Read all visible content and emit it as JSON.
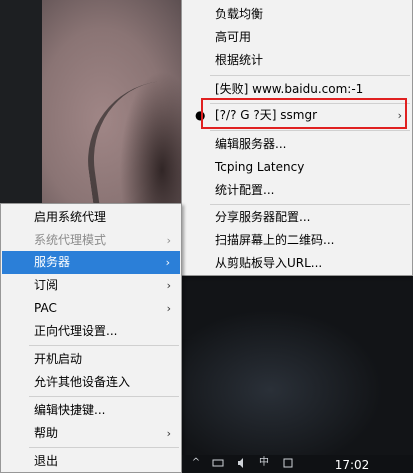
{
  "server_menu": {
    "items": [
      {
        "label": "负载均衡"
      },
      {
        "label": "高可用"
      },
      {
        "label": "根据统计"
      },
      {
        "label": "[失败] www.baidu.com:-1"
      },
      {
        "label": "[?/? G ?天] ssmgr",
        "bullet": "●",
        "arrow": "›"
      },
      {
        "label": "编辑服务器..."
      },
      {
        "label": "Tcping Latency"
      },
      {
        "label": "统计配置..."
      },
      {
        "label": "分享服务器配置..."
      },
      {
        "label": "扫描屏幕上的二维码..."
      },
      {
        "label": "从剪贴板导入URL..."
      }
    ]
  },
  "main_menu": {
    "items": [
      {
        "label": "启用系统代理"
      },
      {
        "label": "系统代理模式",
        "arrow": "›",
        "disabled": true
      },
      {
        "label": "服务器",
        "arrow": "›",
        "highlighted": true
      },
      {
        "label": "订阅",
        "arrow": "›"
      },
      {
        "label": "PAC",
        "arrow": "›"
      },
      {
        "label": "正向代理设置..."
      },
      {
        "label": "开机启动"
      },
      {
        "label": "允许其他设备连入"
      },
      {
        "label": "编辑快捷键..."
      },
      {
        "label": "帮助",
        "arrow": "›"
      },
      {
        "label": "退出"
      }
    ]
  },
  "taskbar": {
    "clock": "17:02",
    "tray_icons": [
      "chevron-up-icon",
      "network-icon",
      "volume-icon",
      "ime-icon",
      "notification-icon"
    ]
  },
  "colors": {
    "menu_bg": "#f2f2f2",
    "highlight": "#2b7fd8",
    "annotation_red": "#e02020"
  }
}
